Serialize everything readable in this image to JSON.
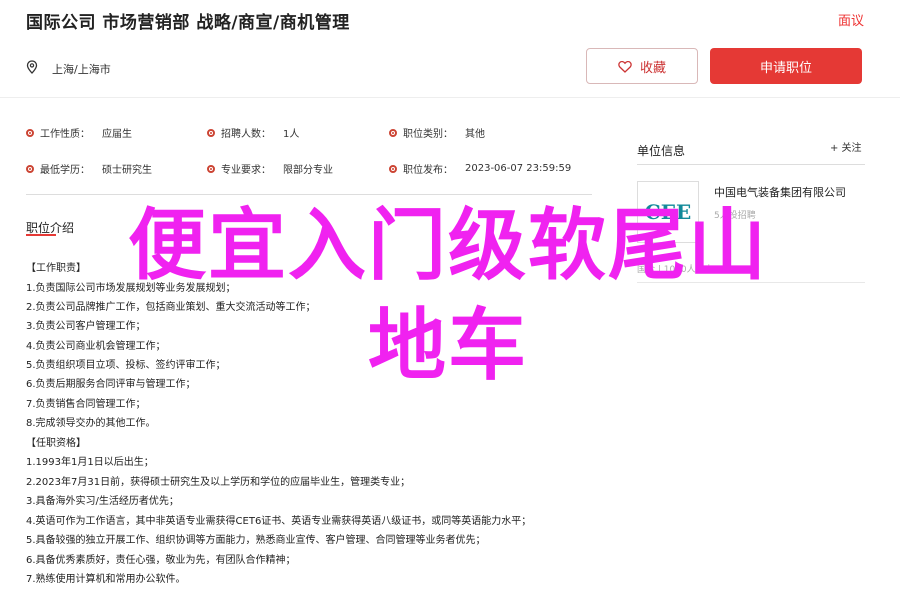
{
  "header": {
    "title": "国际公司 市场营销部 战略/商宣/商机管理",
    "report_label": "面议",
    "location": "上海/上海市",
    "favorite_label": "收藏",
    "apply_label": "申请职位"
  },
  "job_info": [
    {
      "label": "工作性质：",
      "value": "应届生"
    },
    {
      "label": "招聘人数：",
      "value": "1人"
    },
    {
      "label": "职位类别：",
      "value": "其他"
    },
    {
      "label": "最低学历：",
      "value": "硕士研究生"
    },
    {
      "label": "专业要求：",
      "value": "限部分专业"
    },
    {
      "label": "职位发布：",
      "value": "2023-06-07 23:59:59"
    }
  ],
  "description": {
    "section_title": "职位介绍",
    "lines": [
      "【工作职责】",
      "1.负责国际公司市场发展规划等业务发展规划；",
      "2.负责公司品牌推广工作，包括商业策划、重大交流活动等工作；",
      "3.负责公司客户管理工作；",
      "4.负责公司商业机会管理工作；",
      "5.负责组织项目立项、投标、签约评审工作；",
      "6.负责后期服务合同评审与管理工作；",
      "7.负责销售合同管理工作；",
      "8.完成领导交办的其他工作。",
      "【任职资格】",
      "1.1993年1月1日以后出生；",
      "2.2023年7月31日前，获得硕士研究生及以上学历和学位的应届毕业生，管理类专业；",
      "3.具备海外实习/生活经历者优先；",
      "4.英语可作为工作语言，其中非英语专业需获得CET6证书、英语专业需获得英语八级证书，或同等英语能力水平；",
      "5.具备较强的独立开展工作、组织协调等方面能力，熟悉商业宣传、客户管理、合同管理等业务者优先；",
      "6.具备优秀素质好，责任心强，敬业为先，有团队合作精神；",
      "7.熟练使用计算机和常用办公软件。"
    ]
  },
  "sidebar": {
    "title": "单位信息",
    "follow_label": "+ 关注",
    "logo_text": "CEE",
    "company_name": "中国电气装备集团有限公司",
    "company_sub": "5人投招聘",
    "faint_text": "国企 | 1000人以上"
  },
  "overlay": {
    "line1": "便宜入门级软尾山",
    "line2": "地车"
  },
  "colors": {
    "accent": "#e53935",
    "overlay": "#f022f0",
    "logo": "#128a9a"
  }
}
